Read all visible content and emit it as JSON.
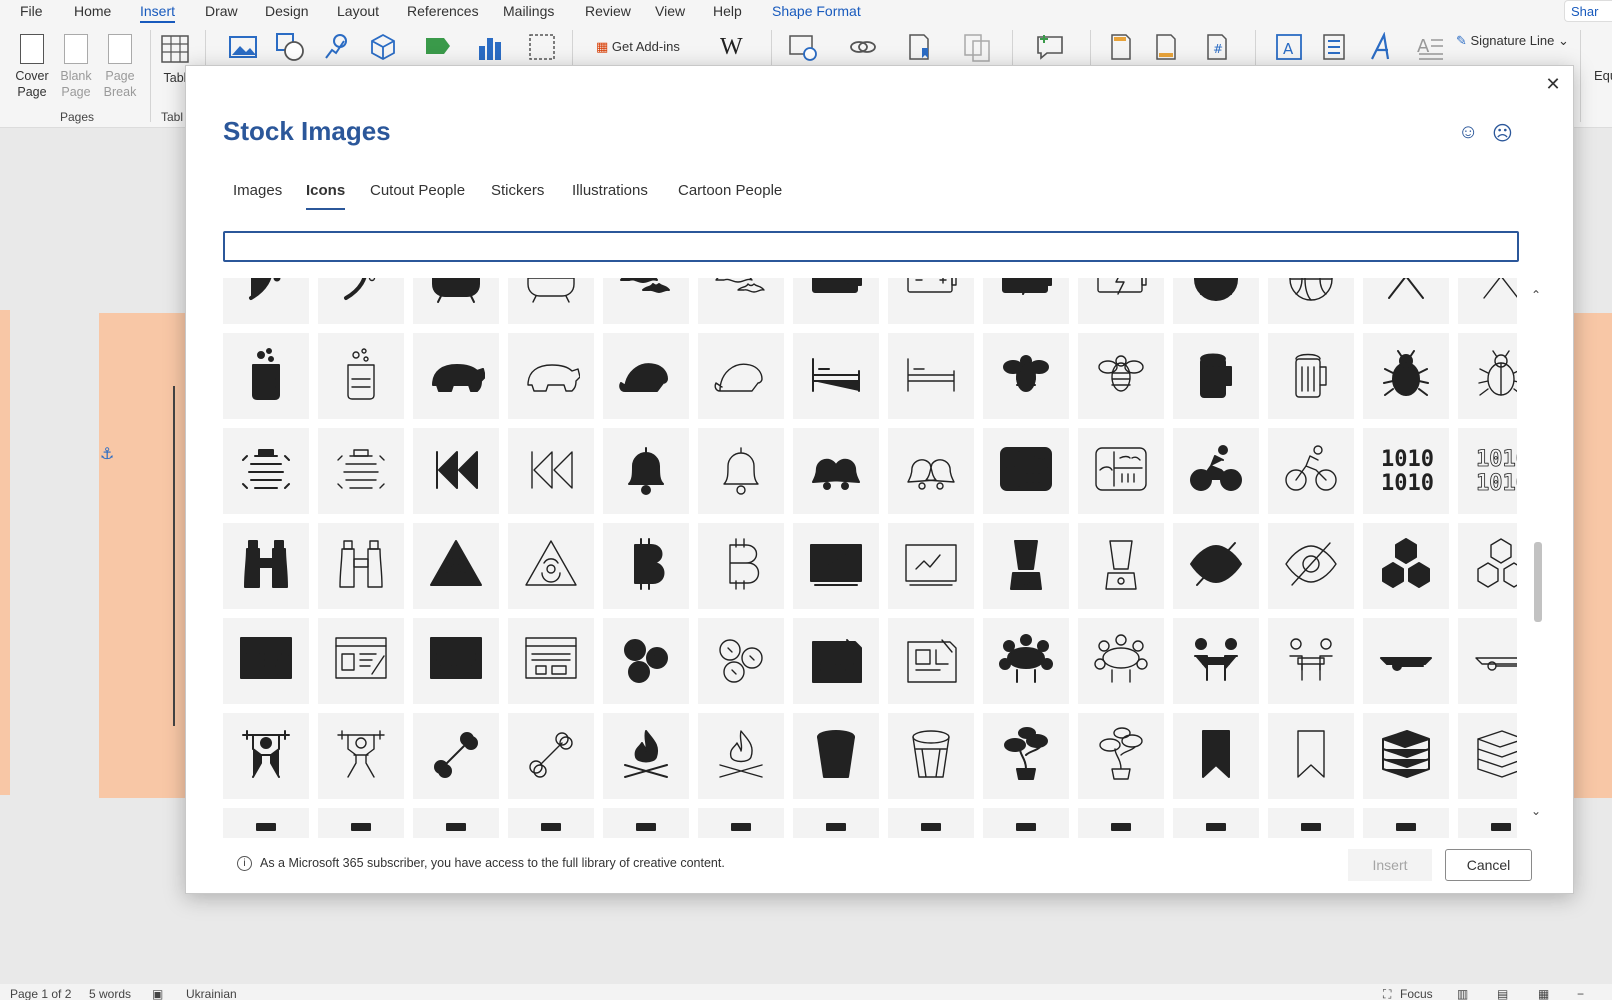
{
  "ribbon": {
    "tabs": [
      "File",
      "Home",
      "Insert",
      "Draw",
      "Design",
      "Layout",
      "References",
      "Mailings",
      "Review",
      "View",
      "Help",
      "Shape Format"
    ],
    "active_tab": "Insert",
    "share_label": "Shar",
    "cover_page": "Cover Page",
    "blank_page": "Blank Page",
    "page_break": "Page Break",
    "table_label": "Tabl",
    "pages_group": "Pages",
    "table_group": "Tabl",
    "get_addins": "Get Add-ins",
    "signature_line": "Signature Line",
    "equation_partial": "Equ"
  },
  "dialog": {
    "title": "Stock Images",
    "tabs": [
      "Images",
      "Icons",
      "Cutout People",
      "Stickers",
      "Illustrations",
      "Cartoon People"
    ],
    "active_tab": "Icons",
    "search_value": "",
    "info_text": "As a Microsoft 365 subscriber, you have access to the full library of creative content.",
    "insert_label": "Insert",
    "cancel_label": "Cancel",
    "close_label": "✕",
    "smile_icon": "smile-icon",
    "frown_icon": "frown-icon"
  },
  "icons": [
    [
      "bass-clef",
      "bass-clef-outline",
      "bathtub",
      "bathtub-outline",
      "bats",
      "bats-outline",
      "battery",
      "battery-outline",
      "battery-charging",
      "battery-charging-outline",
      "basketball",
      "basketball-outline",
      "axes",
      "axes-outline"
    ],
    [
      "beaker",
      "beaker-outline",
      "bear",
      "bear-outline",
      "beaver",
      "beaver-outline",
      "bed",
      "bed-outline",
      "bee",
      "bee-outline",
      "beer",
      "beer-outline",
      "beetle",
      "beetle-outline"
    ],
    [
      "beehive",
      "beehive-outline",
      "rewind",
      "rewind-outline",
      "bell",
      "bell-outline",
      "bells",
      "bells-outline",
      "bento-box",
      "bento-box-outline",
      "cyclist",
      "cyclist-outline",
      "binary",
      "binary-outline"
    ],
    [
      "binoculars",
      "binoculars-outline",
      "biohazard",
      "biohazard-outline",
      "bitcoin",
      "bitcoin-outline",
      "blackboard",
      "blackboard-outline",
      "blender",
      "blender-outline",
      "hidden-eye",
      "hidden-eye-outline",
      "blocks",
      "blocks-outline"
    ],
    [
      "blog",
      "blog-outline",
      "web-page",
      "web-page-outline",
      "blueberries",
      "blueberries-outline",
      "blueprint",
      "blueprint-outline",
      "boardroom",
      "boardroom-outline",
      "meeting",
      "meeting-outline",
      "boat",
      "boat-outline"
    ],
    [
      "bodybuilder",
      "bodybuilder-outline",
      "bone",
      "bone-outline",
      "bonfire",
      "bonfire-outline",
      "bongo-drum",
      "bongo-drum-outline",
      "bonsai",
      "bonsai-outline",
      "bookmark",
      "bookmark-outline",
      "books",
      "books-outline"
    ],
    [
      "partial",
      "partial",
      "partial",
      "partial",
      "partial",
      "partial",
      "partial",
      "partial",
      "partial",
      "partial",
      "partial",
      "partial",
      "partial",
      "partial"
    ]
  ],
  "status": {
    "page": "Page 1 of 2",
    "words": "5 words",
    "language": "Ukrainian",
    "focus": "Focus"
  }
}
